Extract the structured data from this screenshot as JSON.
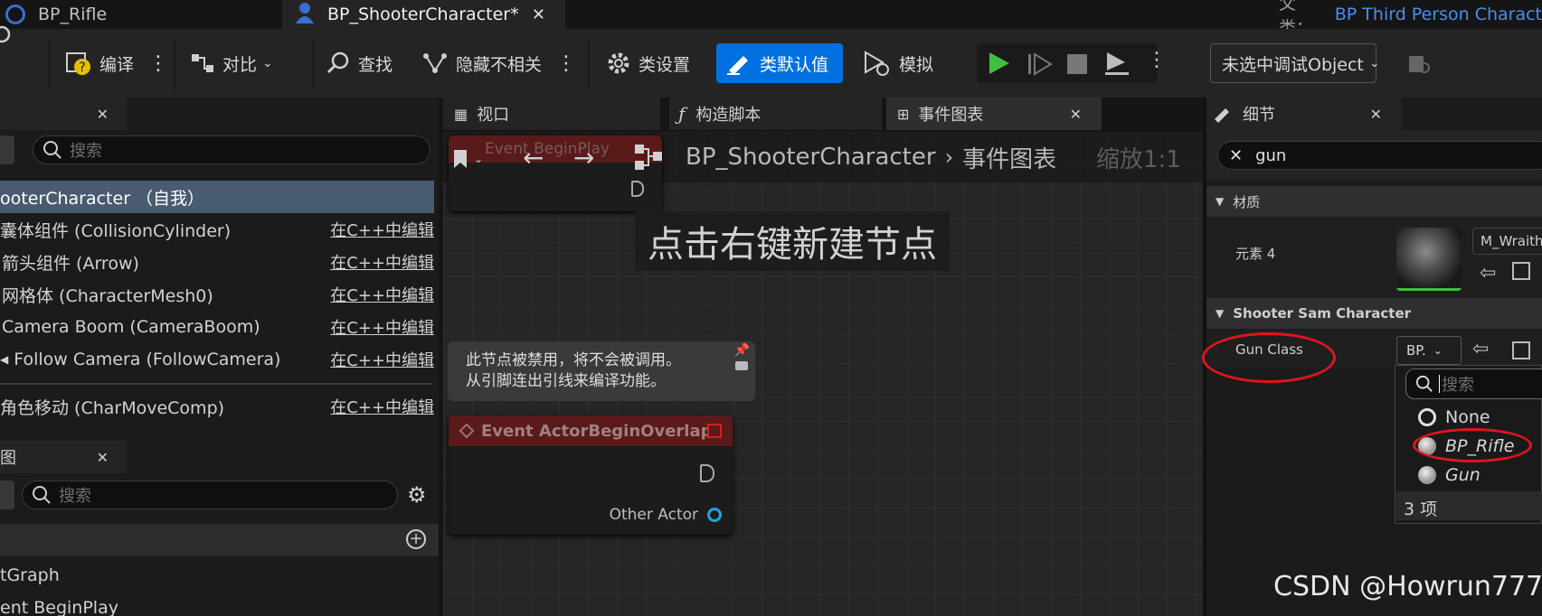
{
  "tabs": [
    {
      "label": "BP_Rifle"
    },
    {
      "label": "BP_ShooterCharacter*"
    }
  ],
  "parent": {
    "label": "父类：",
    "value": "BP Third Person Charact"
  },
  "toolbar": {
    "compile": "编译",
    "diff": "对比",
    "find": "查找",
    "hide_unrelated": "隐藏不相关",
    "class_settings": "类设置",
    "class_defaults": "类默认值",
    "simulate": "模拟",
    "debug_object": "未选中调试Object"
  },
  "components": {
    "search_placeholder": "搜索",
    "rows": [
      {
        "label": "ooterCharacter （自我）",
        "cpp": ""
      },
      {
        "label": "囊体组件 (CollisionCylinder)",
        "cpp": "在C++中编辑"
      },
      {
        "label": "箭头组件 (Arrow)",
        "cpp": "在C++中编辑"
      },
      {
        "label": "网格体 (CharacterMesh0)",
        "cpp": "在C++中编辑"
      },
      {
        "label": "Camera Boom (CameraBoom)",
        "cpp": "在C++中编辑"
      },
      {
        "label": "Follow Camera (FollowCamera)",
        "cpp": "在C++中编辑"
      },
      {
        "label": "角色移动 (CharMoveComp)",
        "cpp": "在C++中编辑"
      }
    ]
  },
  "mybp": {
    "tab_label": "图",
    "search_placeholder": "搜索",
    "items": [
      "tGraph",
      "ent BeginPlay"
    ]
  },
  "editor_tabs": {
    "viewport": "视口",
    "construction": "构造脚本",
    "event_graph": "事件图表"
  },
  "graph": {
    "breadcrumb_root": "BP_ShooterCharacter",
    "breadcrumb_leaf": "事件图表",
    "zoom": "缩放1:1",
    "hint": "点击右键新建节点",
    "node_begin_play": "Event BeginPlay",
    "disabled_comment": "此节点被禁用，将不会被调用。\n从引脚连出引线来编译功能。",
    "node_overlap": "Event ActorBeginOverlap",
    "other_actor_pin": "Other Actor"
  },
  "details": {
    "tab_label": "细节",
    "search_value": "gun",
    "section_material": "材质",
    "element_label": "元素 4",
    "material_name": "M_Wraith",
    "section_shooter": "Shooter Sam Character",
    "gun_class_label": "Gun Class",
    "gun_class_value": "BP.",
    "dropdown_search_placeholder": "搜索",
    "options": [
      "None",
      "BP_Rifle",
      "Gun"
    ],
    "count": "3 项"
  },
  "watermark": "CSDN @Howrun777",
  "colors": {
    "accent": "#0070e0",
    "annotation": "#e0141e",
    "play": "#3fbf3f"
  }
}
